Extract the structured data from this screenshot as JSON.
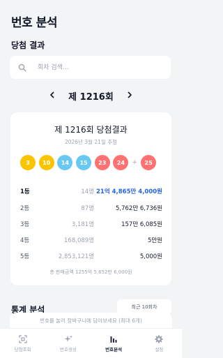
{
  "header": {
    "title": "번호 분석"
  },
  "results": {
    "section_title": "당첨 결과",
    "search_placeholder": "회차 검색...",
    "round_label": "제 1216회",
    "card_title": "제 1216회 당첨결과",
    "draw_date": "2026년 3월 21일 추첨",
    "balls": [
      {
        "num": "3",
        "color": "#fbc400"
      },
      {
        "num": "10",
        "color": "#fbc400"
      },
      {
        "num": "14",
        "color": "#69c8f2"
      },
      {
        "num": "15",
        "color": "#69c8f2"
      },
      {
        "num": "23",
        "color": "#ff7272"
      },
      {
        "num": "24",
        "color": "#ff7272"
      }
    ],
    "plus": "+",
    "bonus": {
      "num": "25",
      "color": "#ff7272"
    },
    "ranks": [
      {
        "rank": "1등",
        "count": "14명",
        "prize": "21억 4,865만 4,000원"
      },
      {
        "rank": "2등",
        "count": "87명",
        "prize": "5,762만 6,736원"
      },
      {
        "rank": "3등",
        "count": "3,181명",
        "prize": "157만 6,085원"
      },
      {
        "rank": "4등",
        "count": "168,089명",
        "prize": "5만원"
      },
      {
        "rank": "5등",
        "count": "2,853,121명",
        "prize": "5,000원"
      }
    ],
    "total_sales": "총 판매금액 1255억 5,652만 6,000원"
  },
  "stats": {
    "title": "통계 분석",
    "chip_label": "최근 10회차"
  },
  "toast": "번호를 눌러 장바구니에 담아보세요 (최대 6개)",
  "tabs": [
    {
      "label": "당첨조회",
      "icon": "qr-scan-icon"
    },
    {
      "label": "번호생성",
      "icon": "sparkle-icon"
    },
    {
      "label": "번호분석",
      "icon": "bar-chart-icon"
    },
    {
      "label": "설정",
      "icon": "gear-icon"
    }
  ],
  "active_tab": "번호분석"
}
